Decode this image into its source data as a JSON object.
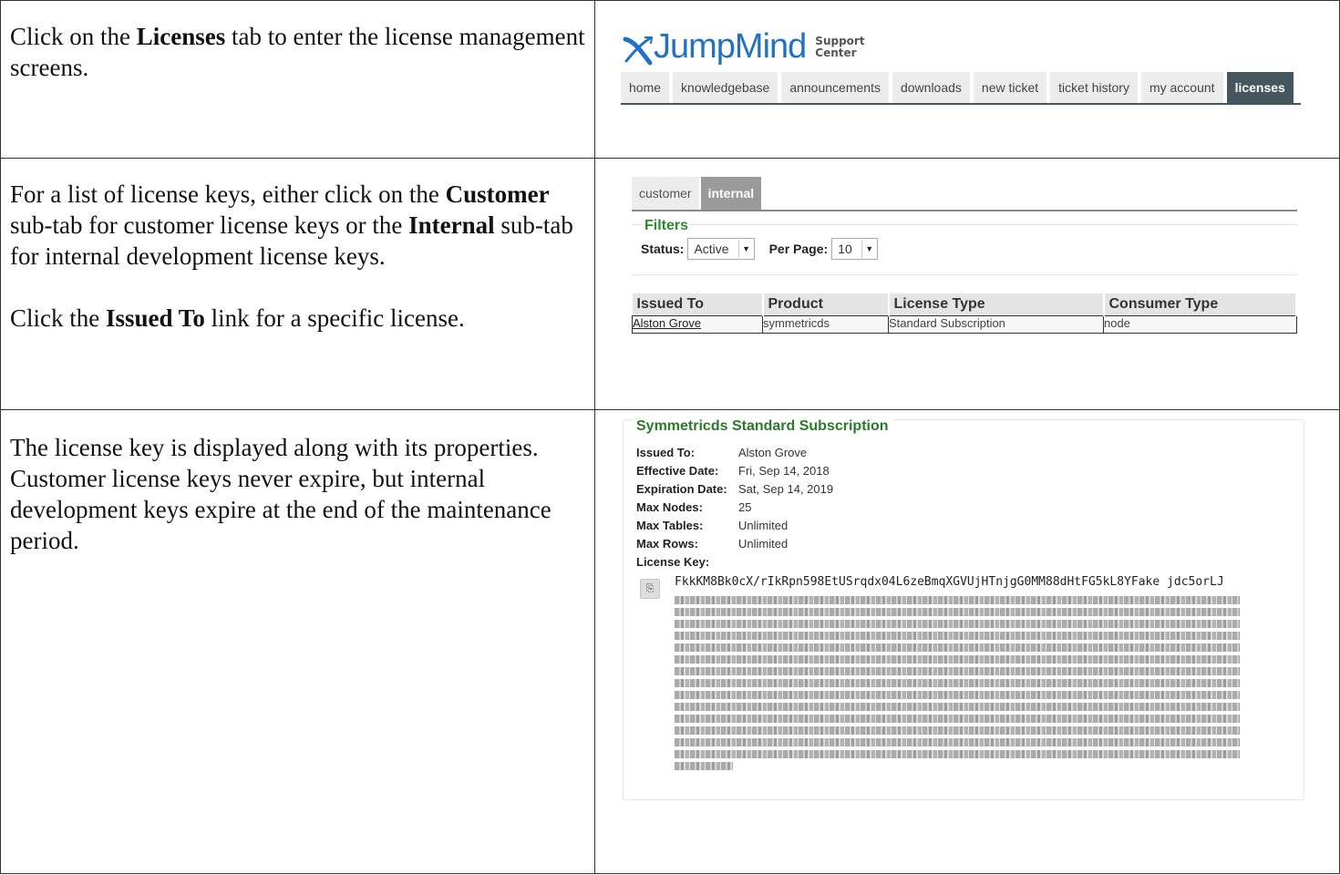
{
  "steps": {
    "step1": {
      "pre": "Click on the ",
      "bold": "Licenses",
      "post": " tab to enter the license management screens."
    },
    "step2": {
      "pre": "For a list of license keys, either click on the ",
      "bold1": "Customer",
      "mid": " sub-tab for customer license keys or the ",
      "bold2": "Internal",
      "post": " sub-tab for internal development license keys.",
      "p2_pre": "Click the ",
      "p2_bold": "Issued To",
      "p2_post": " link for a specific license."
    },
    "step3": {
      "text": "The license key is displayed along with its properties. Customer license keys never expire, but internal development keys expire at the end of the maintenance period."
    }
  },
  "header": {
    "logo_text": "JumpMind",
    "logo_sub1": "Support",
    "logo_sub2": "Center",
    "tabs": [
      "home",
      "knowledgebase",
      "announcements",
      "downloads",
      "new ticket",
      "ticket history",
      "my account",
      "licenses"
    ],
    "active_tab": "licenses"
  },
  "licenses_list": {
    "subtabs": [
      "customer",
      "internal"
    ],
    "active_subtab": "internal",
    "filters_title": "Filters",
    "status_label": "Status:",
    "status_value": "Active",
    "perpage_label": "Per Page:",
    "perpage_value": "10",
    "columns": [
      "Issued To",
      "Product",
      "License Type",
      "Consumer Type"
    ],
    "rows": [
      {
        "issued_to": "Alston Grove",
        "product": "symmetricds",
        "license_type": "Standard Subscription",
        "consumer_type": "node"
      }
    ]
  },
  "license_detail": {
    "title": "Symmetricds Standard Subscription",
    "props": [
      {
        "label": "Issued To:",
        "value": "Alston Grove"
      },
      {
        "label": "Effective Date:",
        "value": "Fri, Sep 14, 2018"
      },
      {
        "label": "Expiration Date:",
        "value": "Sat, Sep 14, 2019"
      },
      {
        "label": "Max Nodes:",
        "value": "25"
      },
      {
        "label": "Max Tables:",
        "value": "Unlimited"
      },
      {
        "label": "Max Rows:",
        "value": "Unlimited"
      }
    ],
    "key_label": "License Key:",
    "key_first_line": "FkkKM8Bk0cX/rIkRpn598EtUSrqdx04L6zeBmqXGVUjHTnjgG0MM88dHtFG5kL8YFake jdc5orLJ",
    "copy_icon": "clipboard-copy-icon"
  },
  "colors": {
    "brand_blue": "#2272c3",
    "nav_active": "#46565f",
    "legend_green": "#2e8a2e"
  }
}
